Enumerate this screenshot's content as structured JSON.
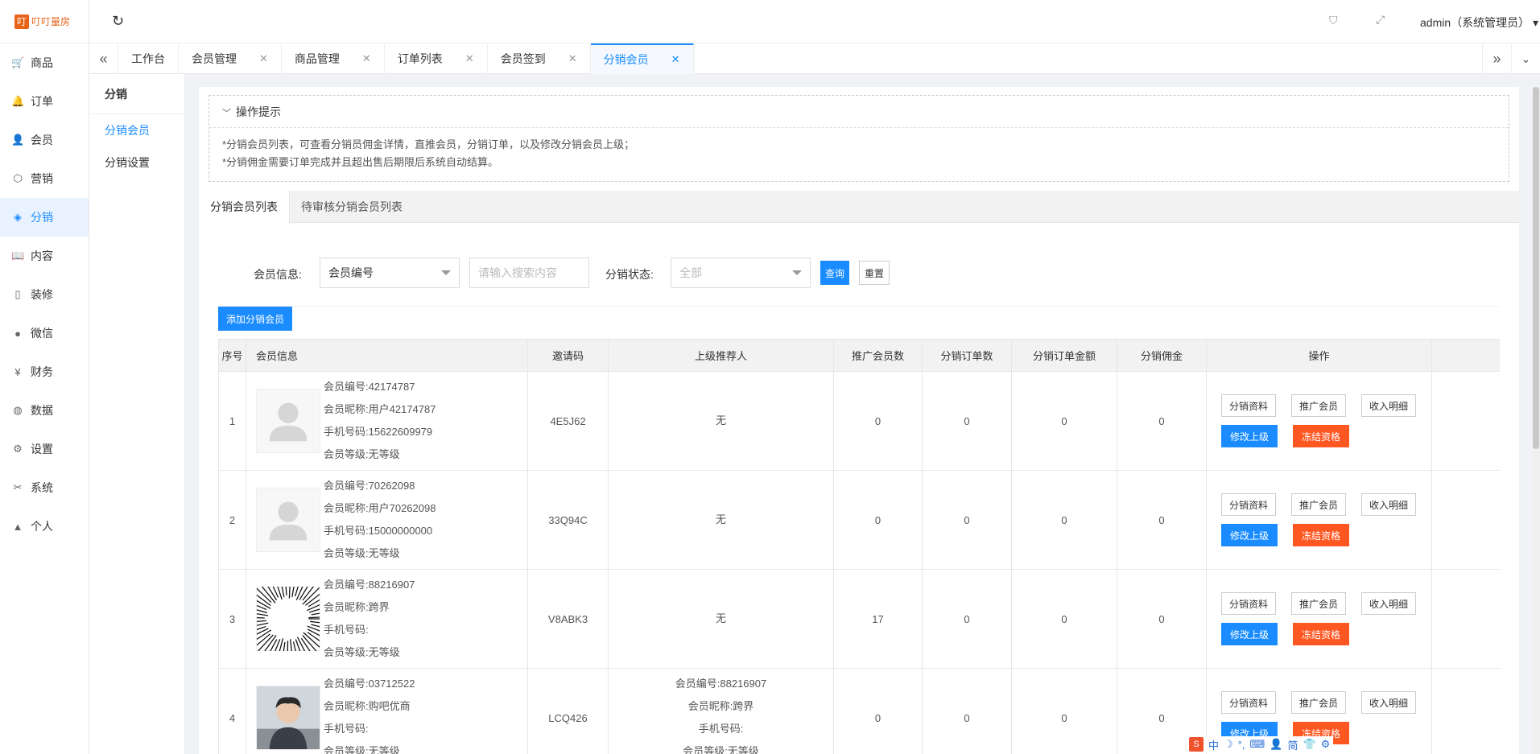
{
  "app": {
    "logo_mark": "叮",
    "logo_text": "叮叮量房",
    "user": "admin（系统管理员）"
  },
  "topbar": {
    "refresh_icon": "refresh-icon",
    "tag_icon": "tag-icon",
    "fullscreen_icon": "fullscreen-icon"
  },
  "leftnav": [
    {
      "label": "商品",
      "icon": "cart-icon",
      "glyph": "🛒"
    },
    {
      "label": "订单",
      "icon": "bell-icon",
      "glyph": "🔔"
    },
    {
      "label": "会员",
      "icon": "user-icon",
      "glyph": "👤"
    },
    {
      "label": "营销",
      "icon": "cube-icon",
      "glyph": "⬡"
    },
    {
      "label": "分销",
      "icon": "layers-icon",
      "glyph": "◈",
      "active": true
    },
    {
      "label": "内容",
      "icon": "book-icon",
      "glyph": "📖"
    },
    {
      "label": "装修",
      "icon": "phone-icon",
      "glyph": "▯"
    },
    {
      "label": "微信",
      "icon": "wechat-icon",
      "glyph": "●"
    },
    {
      "label": "财务",
      "icon": "yen-icon",
      "glyph": "¥"
    },
    {
      "label": "数据",
      "icon": "globe-icon",
      "glyph": "◍"
    },
    {
      "label": "设置",
      "icon": "gear-icon",
      "glyph": "⚙"
    },
    {
      "label": "系统",
      "icon": "tools-icon",
      "glyph": "✂"
    },
    {
      "label": "个人",
      "icon": "person-icon",
      "glyph": "▲"
    }
  ],
  "tabs": [
    {
      "label": "工作台",
      "closable": false
    },
    {
      "label": "会员管理",
      "closable": true
    },
    {
      "label": "商品管理",
      "closable": true
    },
    {
      "label": "订单列表",
      "closable": true
    },
    {
      "label": "会员签到",
      "closable": true
    },
    {
      "label": "分销会员",
      "closable": true,
      "active": true
    }
  ],
  "subnav": {
    "title": "分销",
    "items": [
      {
        "label": "分销会员",
        "active": true
      },
      {
        "label": "分销设置"
      }
    ]
  },
  "hint": {
    "title": "操作提示",
    "lines": [
      "*分销会员列表，可查看分销员佣金详情，直推会员，分销订单，以及修改分销会员上级；",
      "*分销佣金需要订单完成并且超出售后期限后系统自动结算。"
    ]
  },
  "subtabs": [
    "分销会员列表",
    "待审核分销会员列表"
  ],
  "filter": {
    "member_label": "会员信息:",
    "member_select": "会员编号",
    "search_placeholder": "请输入搜索内容",
    "status_label": "分销状态:",
    "status_select": "全部",
    "query": "查询",
    "reset": "重置"
  },
  "add_button": "添加分销会员",
  "table": {
    "headers": [
      "序号",
      "会员信息",
      "邀请码",
      "上级推荐人",
      "推广会员数",
      "分销订单数",
      "分销订单金额",
      "分销佣金",
      "操作",
      ""
    ],
    "op_labels": {
      "profile": "分销资料",
      "promote": "推广会员",
      "income": "收入明细",
      "change": "修改上级",
      "freeze": "冻结资格"
    },
    "rows": [
      {
        "no": "1",
        "avatar": "placeholder",
        "info": [
          "会员编号:42174787",
          "会员昵称:用户42174787",
          "手机号码:15622609979",
          "会员等级:无等级"
        ],
        "code": "4E5J62",
        "upline": [
          "无"
        ],
        "promoted": "0",
        "orders": "0",
        "amount": "0",
        "commission": "0"
      },
      {
        "no": "2",
        "avatar": "placeholder",
        "info": [
          "会员编号:70262098",
          "会员昵称:用户70262098",
          "手机号码:15000000000",
          "会员等级:无等级"
        ],
        "code": "33Q94C",
        "upline": [
          "无"
        ],
        "promoted": "0",
        "orders": "0",
        "amount": "0",
        "commission": "0"
      },
      {
        "no": "3",
        "avatar": "burst",
        "info": [
          "会员编号:88216907",
          "会员昵称:跨界",
          "手机号码:",
          "会员等级:无等级"
        ],
        "code": "V8ABK3",
        "upline": [
          "无"
        ],
        "promoted": "17",
        "orders": "0",
        "amount": "0",
        "commission": "0"
      },
      {
        "no": "4",
        "avatar": "photo",
        "info": [
          "会员编号:03712522",
          "会员昵称:购吧优商",
          "手机号码:",
          "会员等级:无等级"
        ],
        "code": "LCQ426",
        "upline": [
          "会员编号:88216907",
          "会员昵称:跨界",
          "手机号码:",
          "会员等级:无等级"
        ],
        "promoted": "0",
        "orders": "0",
        "amount": "0",
        "commission": "0"
      }
    ]
  },
  "ime": {
    "logo": "S",
    "items": [
      "中",
      "☽",
      "°,",
      "⌨",
      "👤",
      "简",
      "👕",
      "⚙"
    ]
  }
}
